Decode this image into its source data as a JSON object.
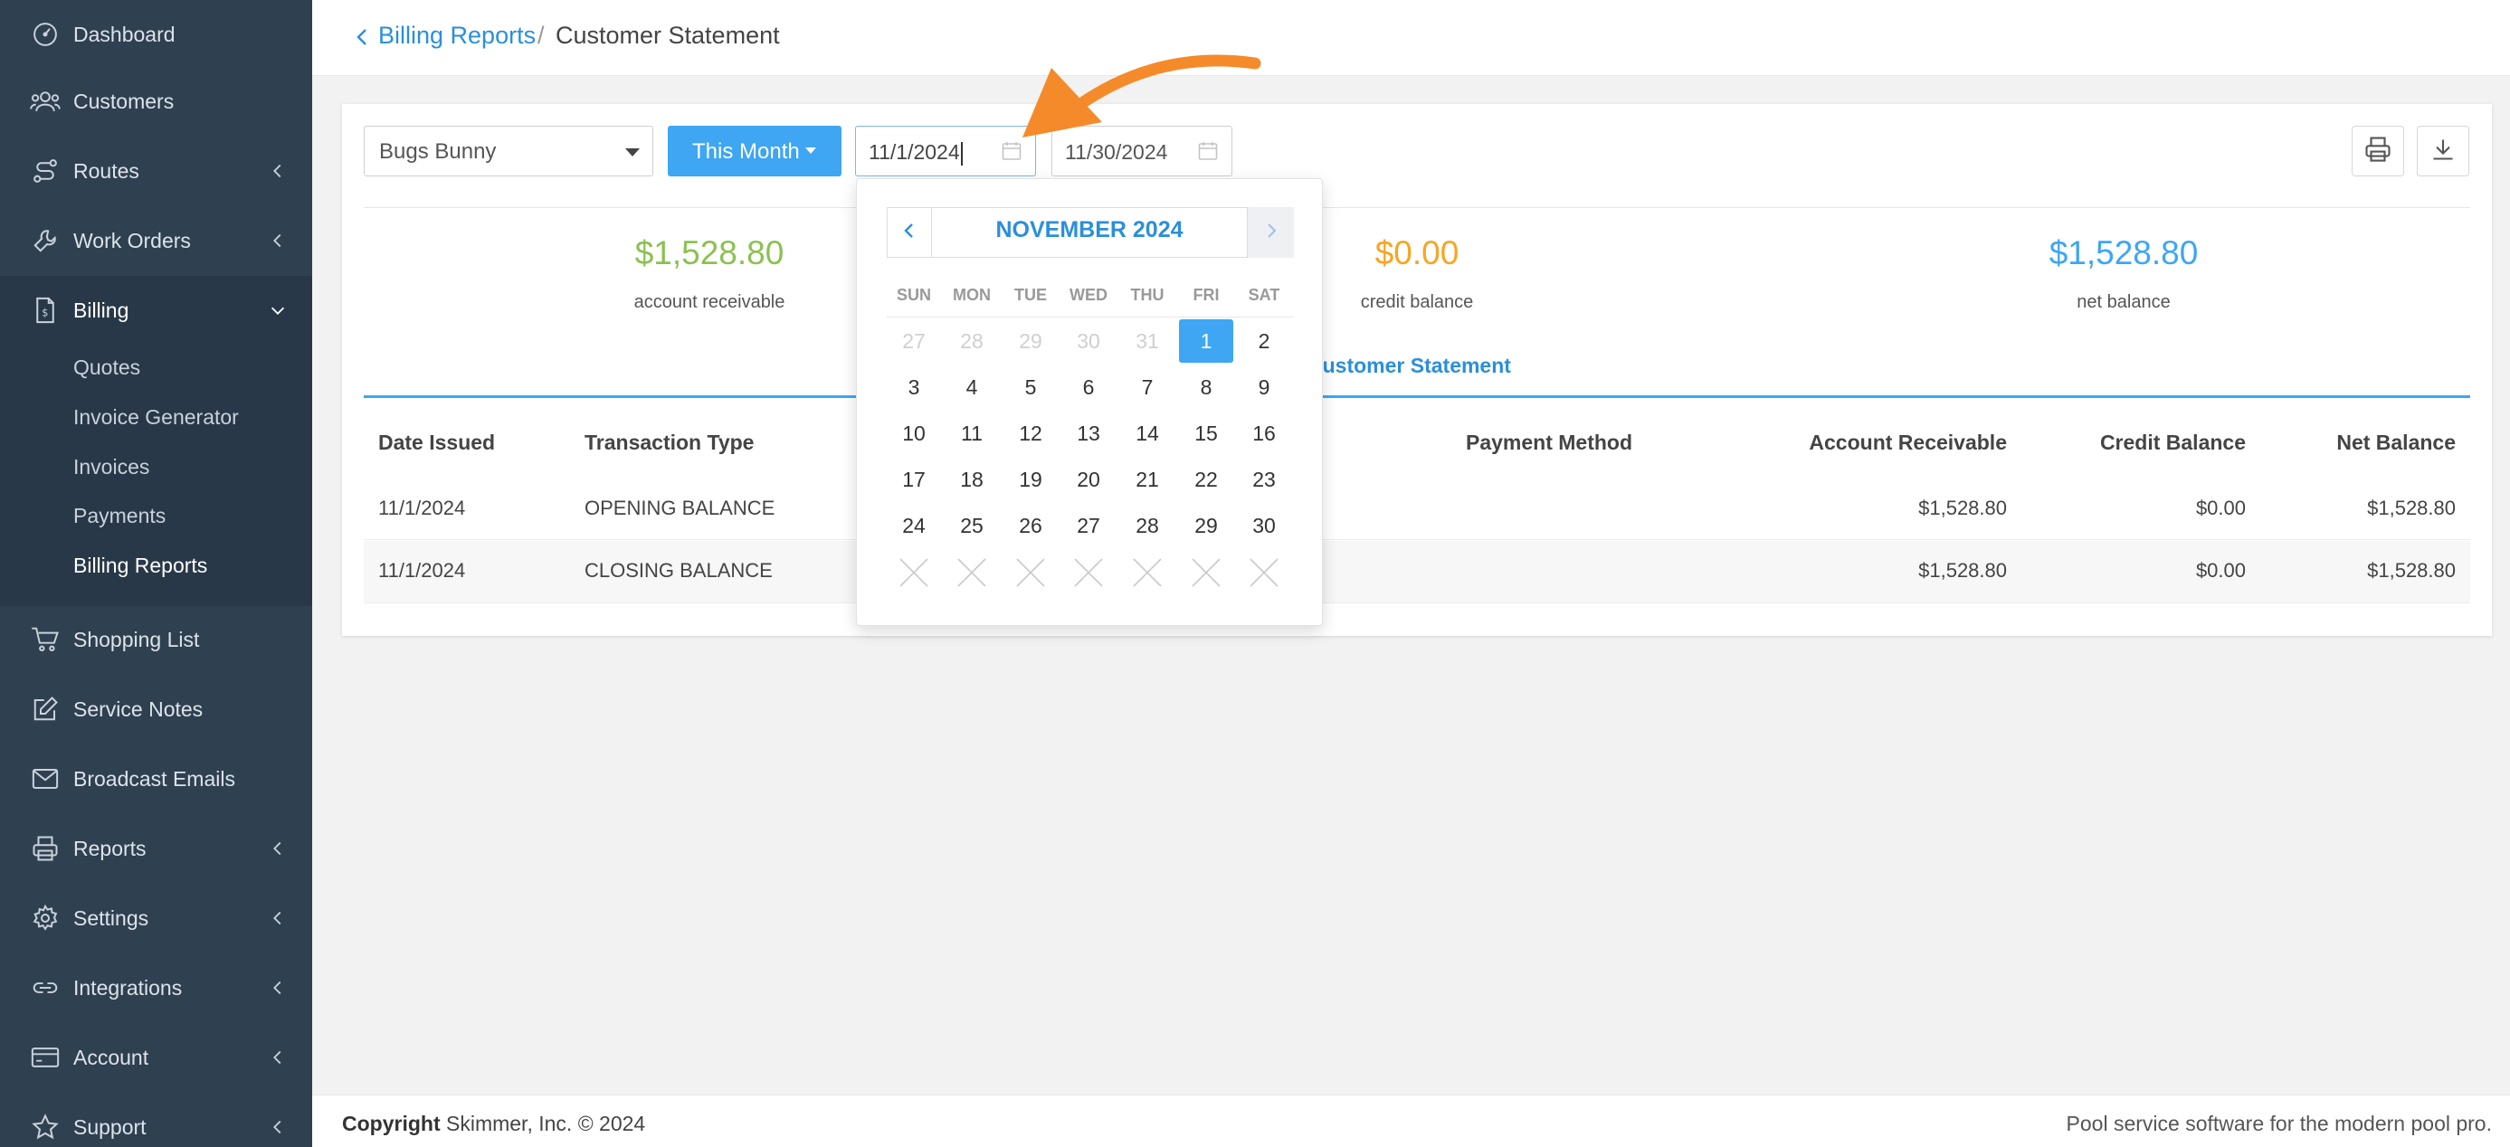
{
  "sidebar": {
    "items": [
      {
        "label": "Dashboard",
        "icon": "dashboard-icon"
      },
      {
        "label": "Customers",
        "icon": "users-icon"
      },
      {
        "label": "Routes",
        "icon": "routes-icon"
      },
      {
        "label": "Work Orders",
        "icon": "wrench-icon"
      },
      {
        "label": "Billing",
        "icon": "invoice-icon"
      },
      {
        "label": "Shopping List",
        "icon": "cart-icon"
      },
      {
        "label": "Service Notes",
        "icon": "edit-icon"
      },
      {
        "label": "Broadcast Emails",
        "icon": "envelope-icon"
      },
      {
        "label": "Reports",
        "icon": "printer-icon"
      },
      {
        "label": "Settings",
        "icon": "gear-icon"
      },
      {
        "label": "Integrations",
        "icon": "link-icon"
      },
      {
        "label": "Account",
        "icon": "card-icon"
      },
      {
        "label": "Support",
        "icon": "star-icon"
      }
    ],
    "billing_sub": [
      "Quotes",
      "Invoice Generator",
      "Invoices",
      "Payments",
      "Billing Reports"
    ]
  },
  "breadcrumb": {
    "parent": "Billing Reports",
    "separator": "/",
    "current": "Customer Statement"
  },
  "filters": {
    "customer": "Bugs Bunny",
    "period": "This Month",
    "start_date": "11/1/2024",
    "end_date": "11/30/2024"
  },
  "summary": [
    {
      "value": "$1,528.80",
      "label": "account receivable",
      "color": "#8cc152"
    },
    {
      "value": "$0.00",
      "label": "credit balance",
      "color": "#f6a623"
    },
    {
      "value": "$1,528.80",
      "label": "net balance",
      "color": "#3ea6f3"
    }
  ],
  "tab": "Customer Statement",
  "table": {
    "headers": [
      "Date Issued",
      "Transaction Type",
      "Payment Method",
      "Account Receivable",
      "Credit Balance",
      "Net Balance"
    ],
    "rows": [
      {
        "date": "11/1/2024",
        "type": "OPENING BALANCE",
        "ar": "$1,528.80",
        "credit": "$0.00",
        "net": "$1,528.80"
      },
      {
        "date": "11/1/2024",
        "type": "CLOSING BALANCE",
        "ar": "$1,528.80",
        "credit": "$0.00",
        "net": "$1,528.80"
      }
    ]
  },
  "datepicker": {
    "title": "NOVEMBER 2024",
    "weekdays": [
      "SUN",
      "MON",
      "TUE",
      "WED",
      "THU",
      "FRI",
      "SAT"
    ],
    "prev_month_days": [
      "27",
      "28",
      "29",
      "30",
      "31"
    ],
    "days": [
      "1",
      "2",
      "3",
      "4",
      "5",
      "6",
      "7",
      "8",
      "9",
      "10",
      "11",
      "12",
      "13",
      "14",
      "15",
      "16",
      "17",
      "18",
      "19",
      "20",
      "21",
      "22",
      "23",
      "24",
      "25",
      "26",
      "27",
      "28",
      "29",
      "30"
    ],
    "selected": "1"
  },
  "footer": {
    "copyright_bold": "Copyright",
    "copyright_text": "Skimmer, Inc. © 2024",
    "tagline": "Pool service software for the modern pool pro."
  },
  "colors": {
    "sidebar": "#2f4050",
    "accent": "#3ea6f3",
    "arrow": "#f58a2a"
  }
}
